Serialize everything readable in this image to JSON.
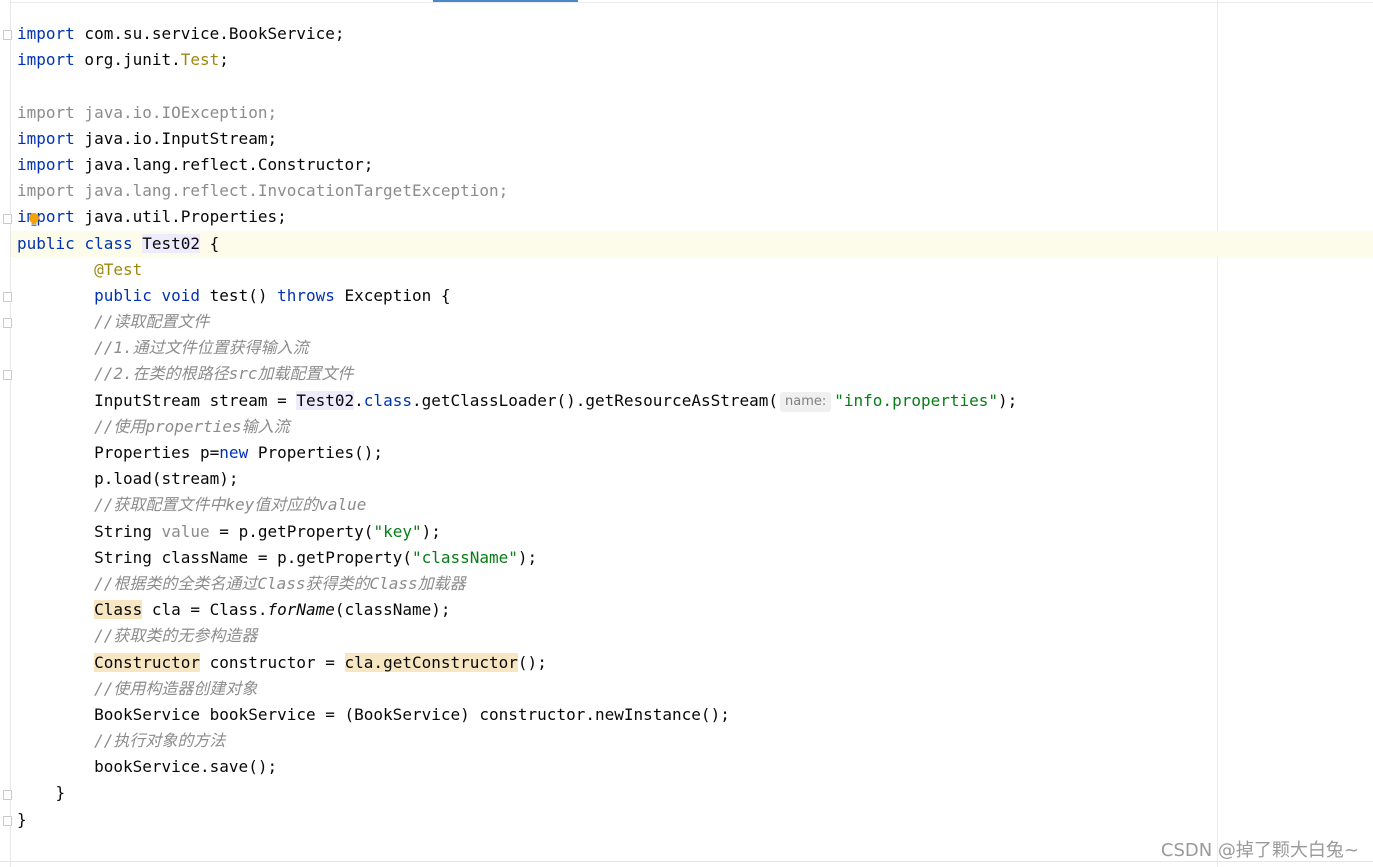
{
  "editor": {
    "lines": {
      "l1": {
        "kw": "import",
        "rest": " com.su.service.BookService;"
      },
      "l2": {
        "kw": "import",
        "pkg": " org.junit.",
        "cls": "Test",
        "end": ";"
      },
      "l4": {
        "kw": "import",
        "rest": " java.io.IOException;"
      },
      "l5": {
        "kw": "import",
        "rest": " java.io.InputStream;"
      },
      "l6": {
        "kw": "import",
        "rest": " java.lang.reflect.Constructor;"
      },
      "l7": {
        "kw": "import",
        "rest": " java.lang.reflect.InvocationTargetException;"
      },
      "l8": {
        "kw": "import",
        "rest": " java.util.Properties;"
      },
      "l9": {
        "kw1": "public",
        "kw2": "class",
        "name": "Test02",
        "end": " {"
      },
      "l10": {
        "annotation": "@Test"
      },
      "l11": {
        "kw1": "public",
        "kw2": "void",
        "method": " test() ",
        "kw3": "throws",
        "end": " Exception {"
      },
      "l12": {
        "comment": "//读取配置文件"
      },
      "l13": {
        "comment": "//1.通过文件位置获得输入流"
      },
      "l14": {
        "comment": "//2.在类的根路径src加载配置文件"
      },
      "l15": {
        "a": "InputStream stream = ",
        "cls": "Test02",
        "dot": ".",
        "kw": "class",
        "b": ".getClassLoader().getResourceAsStream(",
        "hint": "name:",
        "str": "\"info.properties\"",
        "end": ");"
      },
      "l16": {
        "comment": "//使用properties输入流"
      },
      "l17": {
        "a": "Properties p=",
        "kw": "new",
        "b": " Properties();"
      },
      "l18": {
        "text": "p.load(stream);"
      },
      "l19": {
        "comment": "//获取配置文件中key值对应的value"
      },
      "l20": {
        "a": "String ",
        "unused": "value",
        "b": " = p.getProperty(",
        "str": "\"key\"",
        "end": ");"
      },
      "l21": {
        "a": "String className = p.getProperty(",
        "str": "\"className\"",
        "end": ");"
      },
      "l22": {
        "comment": "//根据类的全类名通过Class获得类的Class加载器"
      },
      "l23": {
        "warn": "Class",
        "a": " cla = Class.",
        "italic": "forName",
        "b": "(className);"
      },
      "l24": {
        "comment": "//获取类的无参构造器"
      },
      "l25": {
        "warn1": "Constructor",
        "a": " constructor = ",
        "warn2": "cla.getConstructor",
        "b": "();"
      },
      "l26": {
        "comment": "//使用构造器创建对象"
      },
      "l27": {
        "text": "BookService bookService = (BookService) constructor.newInstance();"
      },
      "l28": {
        "comment": "//执行对象的方法"
      },
      "l29": {
        "text": "bookService.save();"
      },
      "l30": {
        "text": "    }"
      },
      "l31": {
        "text": "}"
      }
    }
  },
  "watermark": "CSDN @掉了颗大白兔~",
  "colors": {
    "keyword": "#0033b3",
    "string": "#067d17",
    "comment": "#8c8c8c",
    "annotation": "#9e880d",
    "current_line": "#fdfbea",
    "warning_highlight": "#f7e6c2",
    "class_highlight": "#edebfc"
  },
  "icons": {
    "fold_marker": "fold-icon",
    "intention_bulb": "lightbulb-icon"
  }
}
